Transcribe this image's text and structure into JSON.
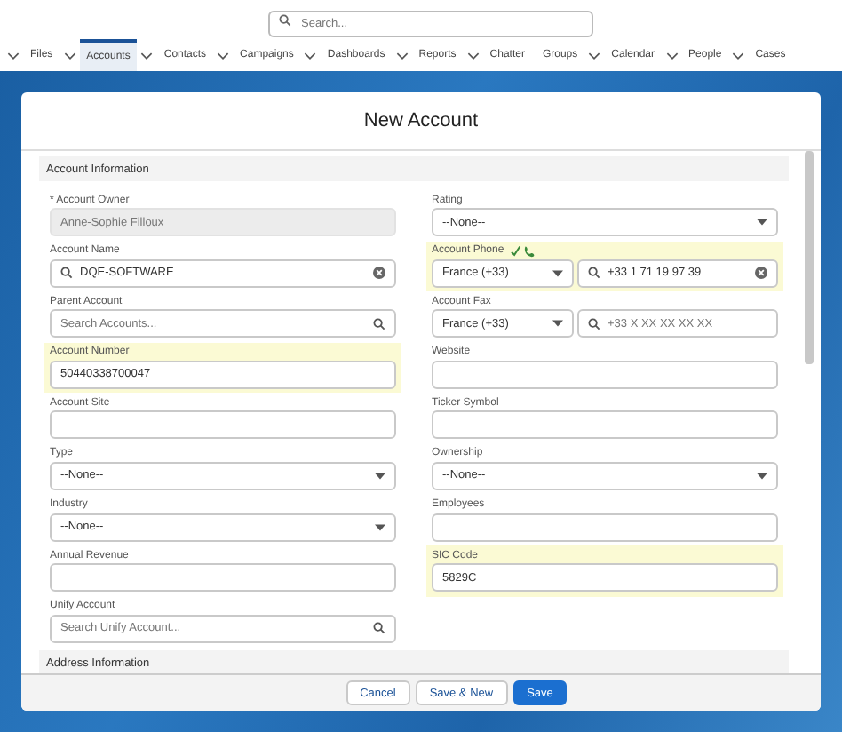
{
  "search": {
    "placeholder": "Search..."
  },
  "nav": [
    {
      "label": "Files",
      "caret": true,
      "selected": false
    },
    {
      "label": "Accounts",
      "caret": true,
      "selected": true
    },
    {
      "label": "Contacts",
      "caret": true,
      "selected": false
    },
    {
      "label": "Campaigns",
      "caret": true,
      "selected": false
    },
    {
      "label": "Dashboards",
      "caret": true,
      "selected": false
    },
    {
      "label": "Reports",
      "caret": true,
      "selected": false
    },
    {
      "label": "Chatter",
      "caret": false,
      "selected": false
    },
    {
      "label": "Groups",
      "caret": true,
      "selected": false
    },
    {
      "label": "Calendar",
      "caret": true,
      "selected": false
    },
    {
      "label": "People",
      "caret": true,
      "selected": false
    },
    {
      "label": "Cases",
      "caret": false,
      "selected": false
    }
  ],
  "modal": {
    "title": "New Account",
    "section": "Account Information",
    "next_section": "Address Information",
    "left": [
      {
        "label": "* Account Owner",
        "kind": "text",
        "value": "Anne-Sophie Filloux",
        "disabled": true,
        "highlighted": false
      },
      {
        "label": "Account Name",
        "kind": "lookup",
        "value": "DQE-SOFTWARE",
        "highlighted": false
      },
      {
        "label": "Parent Account",
        "kind": "lookup",
        "placeholder": "Search Accounts...",
        "highlighted": false
      },
      {
        "label": "Account Number",
        "kind": "text",
        "value": "50440338700047",
        "disabled": false,
        "highlighted": true
      },
      {
        "label": "Account Site",
        "kind": "text",
        "disabled": false,
        "highlighted": false
      },
      {
        "label": "Type",
        "kind": "select",
        "value": "--None--",
        "highlighted": false
      },
      {
        "label": "Industry",
        "kind": "select",
        "value": "--None--",
        "highlighted": false
      },
      {
        "label": "Annual Revenue",
        "kind": "text",
        "disabled": false,
        "highlighted": false
      },
      {
        "label": "Unify Account",
        "kind": "lookup",
        "placeholder": "Search Unify Account...",
        "highlighted": false
      }
    ],
    "right": [
      {
        "label": "Rating",
        "kind": "select",
        "value": "--None--",
        "highlighted": false
      },
      {
        "label": "Account Phone",
        "kind": "phone",
        "country": "France (+33)",
        "value": "+33 1 71 19 97 39",
        "verified": true,
        "highlighted": true
      },
      {
        "label": "Account Fax",
        "kind": "phone",
        "country": "France (+33)",
        "placeholder": "+33 X XX XX XX XX",
        "verified": false,
        "highlighted": false
      },
      {
        "label": "Website",
        "kind": "text",
        "disabled": false,
        "highlighted": false
      },
      {
        "label": "Ticker Symbol",
        "kind": "text",
        "disabled": false,
        "highlighted": false
      },
      {
        "label": "Ownership",
        "kind": "select",
        "value": "--None--",
        "highlighted": false
      },
      {
        "label": "Employees",
        "kind": "text",
        "disabled": false,
        "highlighted": false
      },
      {
        "label": "SIC Code",
        "kind": "text",
        "value": "5829C",
        "disabled": false,
        "highlighted": true
      }
    ],
    "buttons": [
      {
        "label": "Cancel",
        "kind": "neutral"
      },
      {
        "label": "Save & New",
        "kind": "neutral"
      },
      {
        "label": "Save",
        "kind": "brand"
      }
    ]
  }
}
